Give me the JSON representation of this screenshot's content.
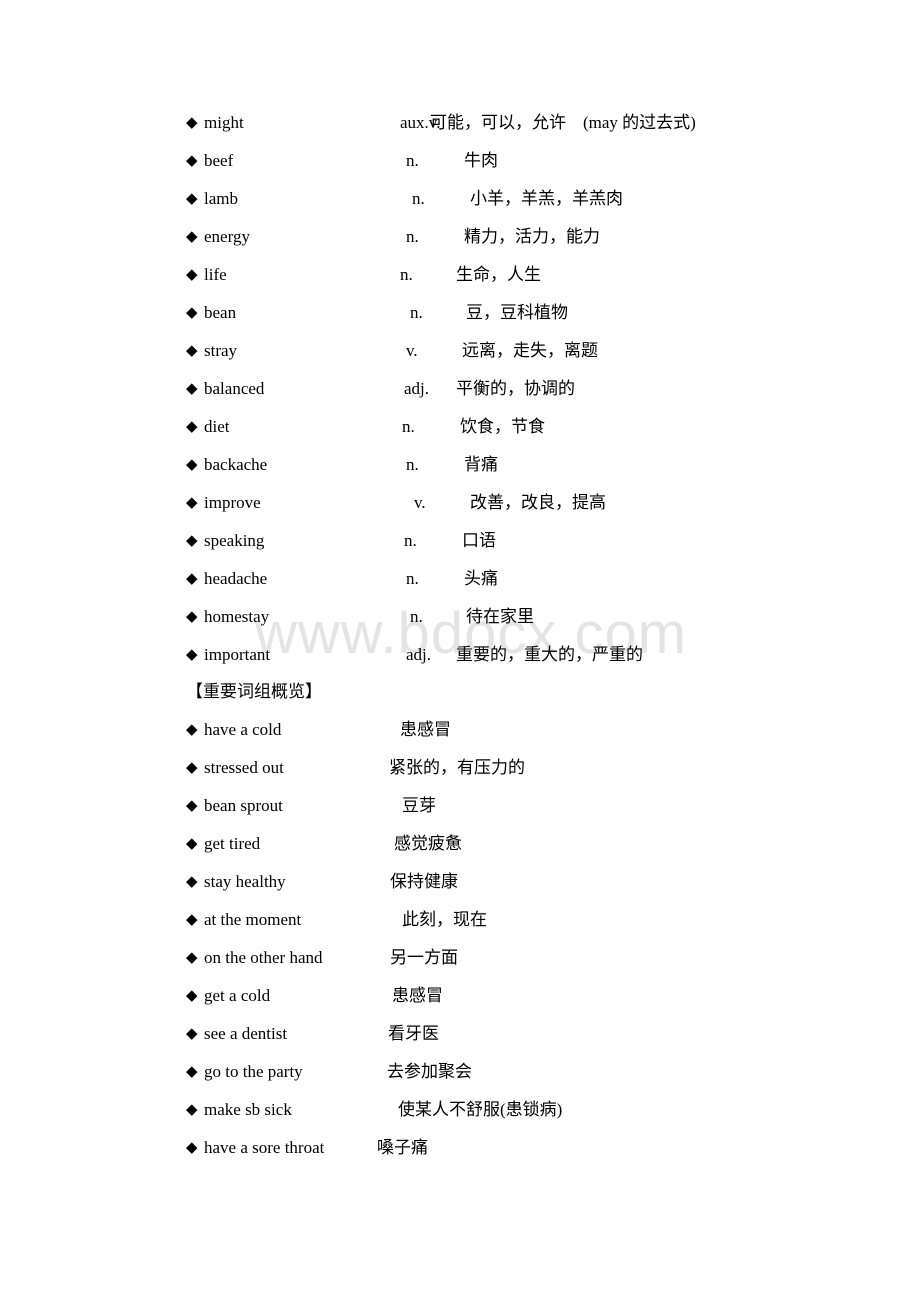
{
  "watermark": "www.bdocx.com",
  "vocab": [
    {
      "word": "might",
      "pos": "aux.v.",
      "meaning": "可能，可以，允许　(may 的过去式)"
    },
    {
      "word": "beef",
      "pos": "n.",
      "meaning": "牛肉"
    },
    {
      "word": "lamb",
      "pos": "n.",
      "meaning": "小羊，羊羔，羊羔肉"
    },
    {
      "word": "energy",
      "pos": "n.",
      "meaning": "精力，活力，能力"
    },
    {
      "word": "life",
      "pos": "n.",
      "meaning": "生命，人生"
    },
    {
      "word": "bean",
      "pos": "n.",
      "meaning": "豆，豆科植物"
    },
    {
      "word": "stray",
      "pos": "v.",
      "meaning": "远离，走失，离题"
    },
    {
      "word": "balanced",
      "pos": "adj.",
      "meaning": "平衡的，协调的"
    },
    {
      "word": "diet",
      "pos": "n.",
      "meaning": "饮食，节食"
    },
    {
      "word": "backache",
      "pos": "n.",
      "meaning": "背痛"
    },
    {
      "word": "improve",
      "pos": "v.",
      "meaning": "改善，改良，提高"
    },
    {
      "word": "speaking",
      "pos": "n.",
      "meaning": "口语"
    },
    {
      "word": "headache",
      "pos": "n.",
      "meaning": "头痛"
    },
    {
      "word": "homestay",
      "pos": "n.",
      "meaning": "待在家里"
    },
    {
      "word": "important",
      "pos": "adj.",
      "meaning": "重要的，重大的，严重的"
    }
  ],
  "phrases_heading": "【重要词组概览】",
  "phrases": [
    {
      "phrase": "have a cold",
      "meaning": "患感冒"
    },
    {
      "phrase": "stressed out",
      "meaning": "紧张的，有压力的"
    },
    {
      "phrase": "bean sprout",
      "meaning": "豆芽"
    },
    {
      "phrase": "get tired",
      "meaning": "感觉疲惫"
    },
    {
      "phrase": "stay healthy",
      "meaning": "保持健康"
    },
    {
      "phrase": "at the moment",
      "meaning": "此刻，现在"
    },
    {
      "phrase": "on the other hand",
      "meaning": "另一方面"
    },
    {
      "phrase": "get a cold",
      "meaning": "患感冒"
    },
    {
      "phrase": "see a dentist",
      "meaning": "看牙医"
    },
    {
      "phrase": "go to the party",
      "meaning": "去参加聚会"
    },
    {
      "phrase": "make sb sick",
      "meaning": "使某人不舒服(患锁病)"
    },
    {
      "phrase": "have a sore throat",
      "meaning": "嗓子痛"
    }
  ],
  "bullet_icon": "diamond-bullet-icon"
}
